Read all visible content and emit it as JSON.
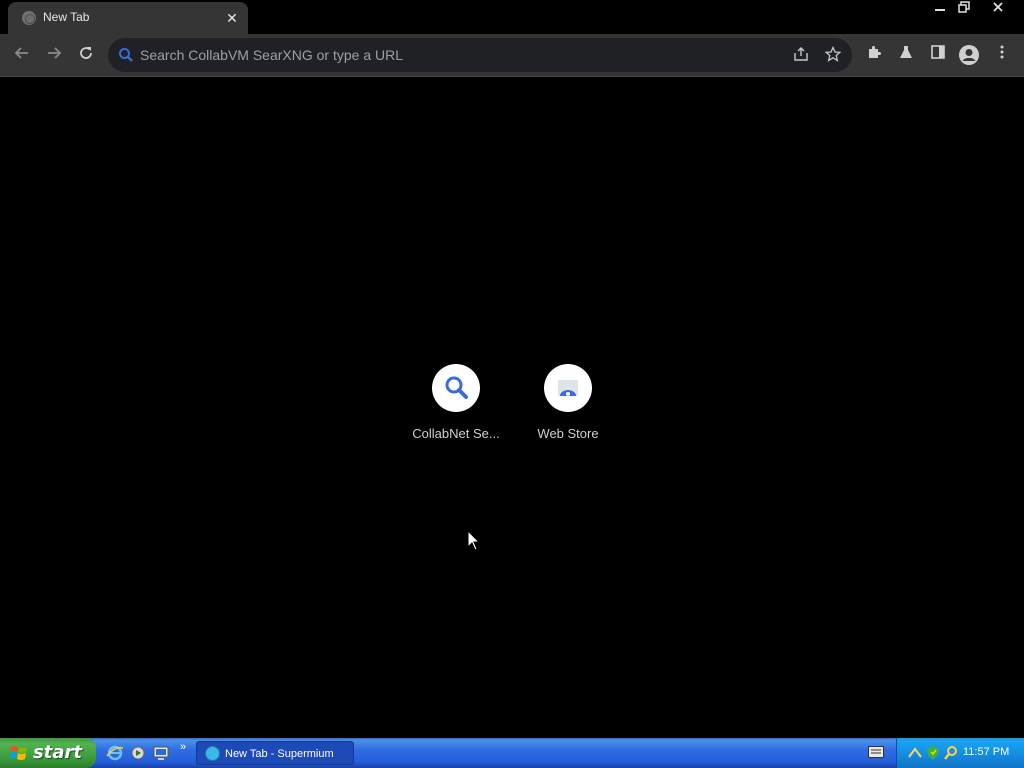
{
  "window": {
    "tab_title": "New Tab",
    "tab_close": "✕",
    "minimize": "—",
    "restore": "❐",
    "close": "✕"
  },
  "toolbar": {
    "back_icon": "back-arrow-icon",
    "forward_icon": "forward-arrow-icon",
    "reload_icon": "reload-icon",
    "omnibox_placeholder": "Search CollabVM SearXNG or type a URL",
    "omnibox_value": "",
    "share_icon": "share-icon",
    "bookmark_icon": "star-icon",
    "extensions_icon": "puzzle-icon",
    "labs_icon": "flask-icon",
    "sidepanel_icon": "side-panel-icon",
    "profile_icon": "profile-icon",
    "menu_icon": "kebab-menu-icon"
  },
  "shortcuts": [
    {
      "label": "CollabNet Se...",
      "icon": "search-icon"
    },
    {
      "label": "Web Store",
      "icon": "web-store-icon"
    }
  ],
  "taskbar": {
    "start_label": "start",
    "quick_launch": [
      "ie-icon",
      "media-icon",
      "show-desktop-icon"
    ],
    "task_label": "New Tab - Supermium",
    "clock": "11:57 PM"
  },
  "colors": {
    "page_bg": "#000000",
    "toolbar_bg": "#353535",
    "omnibox_bg": "#202124",
    "accent_search": "#3b6ad9",
    "taskbar_blue": "#245edb",
    "start_green": "#3a9a3a"
  }
}
